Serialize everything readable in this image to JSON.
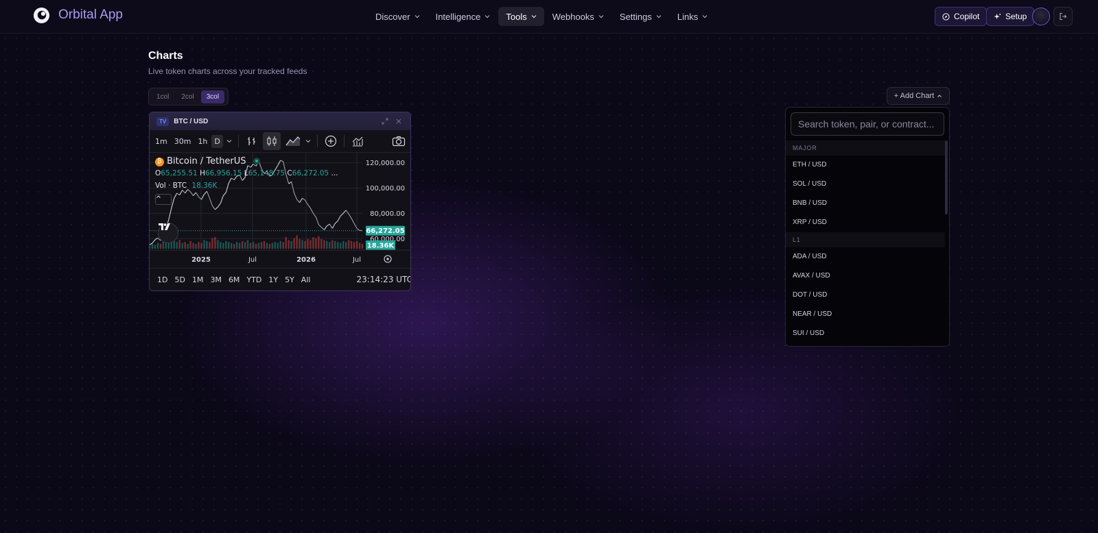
{
  "nav": {
    "app_name": "Orbital App",
    "menu": [
      {
        "label": "Discover"
      },
      {
        "label": "Intelligence"
      },
      {
        "label": "Tools",
        "active": true
      },
      {
        "label": "Webhooks"
      },
      {
        "label": "Settings"
      },
      {
        "label": "Links"
      }
    ],
    "copilot_label": "Copilot",
    "setup_label": "Setup"
  },
  "page": {
    "title": "Charts",
    "subtitle": "Live token charts across your tracked feeds",
    "layout_options": [
      "1col",
      "2col",
      "3col"
    ],
    "selected_layout": "3col",
    "add_chart_label": "+ Add Chart"
  },
  "chart_widget": {
    "badge": "TV",
    "pair": "BTC / USD",
    "intervals": [
      "1m",
      "30m",
      "1h",
      "D"
    ],
    "active_interval": "D",
    "symbol_name": "Bitcoin / TetherUS",
    "ohlc": {
      "o_label": "O",
      "o": "65,255.51",
      "h_label": "H",
      "h": "66,956.15",
      "l_label": "L",
      "l": "65,148.75",
      "c_label": "C",
      "c": "66,272.05",
      "more": "..."
    },
    "volume_label": "Vol · BTC",
    "volume_value": "18.36K",
    "last_price_tag": "66,272.05",
    "volume_tag": "18.36K",
    "ranges": [
      "1D",
      "5D",
      "1M",
      "3M",
      "6M",
      "YTD",
      "1Y",
      "5Y",
      "All"
    ],
    "time": "23:14:23 UTC",
    "colors": {
      "up": "#26a69a",
      "down": "#ef5350"
    }
  },
  "chart_data": {
    "type": "line",
    "title": "Bitcoin / TetherUS",
    "x_ticks": [
      "2025",
      "Jul",
      "2026",
      "Jul"
    ],
    "y_ticks": [
      "120,000.00",
      "100,000.00",
      "80,000.00",
      "60,000.00"
    ],
    "y_tick_values": [
      120000,
      100000,
      80000,
      60000
    ],
    "ylim": [
      52000,
      128000
    ],
    "series": [
      {
        "values": [
          55000,
          56500,
          59000,
          60500,
          58500,
          63000,
          68000,
          75000,
          84000,
          92000,
          96000,
          94500,
          98500,
          96000,
          99000,
          97000,
          94000,
          96500,
          93000,
          91000,
          95000,
          97500,
          92000,
          86000,
          83000,
          85000,
          88000,
          94000,
          96500,
          104000,
          108000,
          106500,
          109500,
          110500,
          106000,
          108500,
          118000,
          116500,
          119000,
          117500,
          121500,
          115500,
          111500,
          113500,
          109500,
          110500,
          114500,
          118000,
          122000,
          121000,
          111000,
          103500,
          105000,
          96000,
          91000,
          88500,
          92000,
          90500,
          87000,
          84000,
          80000,
          77000,
          71000,
          69000,
          67000,
          70000,
          71500,
          68000,
          72000,
          74000,
          78000,
          80000,
          82500,
          79500,
          76000,
          72000,
          68000,
          66500,
          66272
        ]
      }
    ],
    "volume": [
      3,
      5,
      4,
      6,
      5,
      7,
      9,
      12,
      10,
      8,
      7,
      9,
      6,
      7,
      5,
      8,
      6,
      5,
      7,
      6,
      9,
      8,
      7,
      11,
      12,
      9,
      7,
      6,
      8,
      7,
      6,
      5,
      7,
      6,
      8,
      7,
      9,
      6,
      7,
      5,
      6,
      7,
      8,
      6,
      5,
      6,
      7,
      6,
      8,
      7,
      12,
      9,
      8,
      11,
      14,
      10,
      9,
      8,
      10,
      9,
      12,
      11,
      13,
      10,
      9,
      8,
      7,
      9,
      8,
      7,
      6,
      8,
      7,
      9,
      8,
      7,
      8,
      6,
      5
    ]
  },
  "dropdown": {
    "search_placeholder": "Search token, pair, or contract...",
    "groups": [
      {
        "name": "MAJOR",
        "items": [
          "ETH / USD",
          "SOL / USD",
          "BNB / USD",
          "XRP / USD"
        ]
      },
      {
        "name": "L1",
        "items": [
          "ADA / USD",
          "AVAX / USD",
          "DOT / USD",
          "NEAR / USD",
          "SUI / USD"
        ]
      }
    ]
  },
  "icons": {
    "logo": "orbital-logo-icon",
    "copilot": "compass-icon",
    "setup": "sparkle-icon",
    "logout": "logout-icon"
  }
}
